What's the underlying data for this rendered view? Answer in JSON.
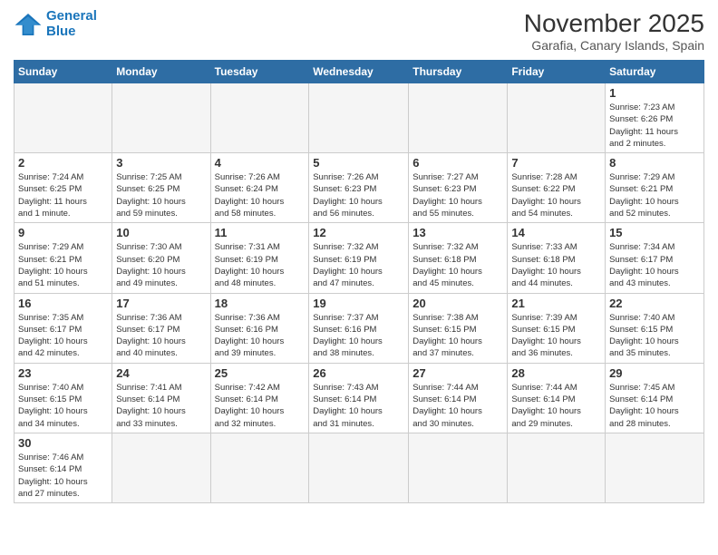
{
  "logo": {
    "line1": "General",
    "line2": "Blue"
  },
  "header": {
    "title": "November 2025",
    "subtitle": "Garafia, Canary Islands, Spain"
  },
  "weekdays": [
    "Sunday",
    "Monday",
    "Tuesday",
    "Wednesday",
    "Thursday",
    "Friday",
    "Saturday"
  ],
  "weeks": [
    [
      {
        "day": "",
        "info": ""
      },
      {
        "day": "",
        "info": ""
      },
      {
        "day": "",
        "info": ""
      },
      {
        "day": "",
        "info": ""
      },
      {
        "day": "",
        "info": ""
      },
      {
        "day": "",
        "info": ""
      },
      {
        "day": "1",
        "info": "Sunrise: 7:23 AM\nSunset: 6:26 PM\nDaylight: 11 hours\nand 2 minutes."
      }
    ],
    [
      {
        "day": "2",
        "info": "Sunrise: 7:24 AM\nSunset: 6:25 PM\nDaylight: 11 hours\nand 1 minute."
      },
      {
        "day": "3",
        "info": "Sunrise: 7:25 AM\nSunset: 6:25 PM\nDaylight: 10 hours\nand 59 minutes."
      },
      {
        "day": "4",
        "info": "Sunrise: 7:26 AM\nSunset: 6:24 PM\nDaylight: 10 hours\nand 58 minutes."
      },
      {
        "day": "5",
        "info": "Sunrise: 7:26 AM\nSunset: 6:23 PM\nDaylight: 10 hours\nand 56 minutes."
      },
      {
        "day": "6",
        "info": "Sunrise: 7:27 AM\nSunset: 6:23 PM\nDaylight: 10 hours\nand 55 minutes."
      },
      {
        "day": "7",
        "info": "Sunrise: 7:28 AM\nSunset: 6:22 PM\nDaylight: 10 hours\nand 54 minutes."
      },
      {
        "day": "8",
        "info": "Sunrise: 7:29 AM\nSunset: 6:21 PM\nDaylight: 10 hours\nand 52 minutes."
      }
    ],
    [
      {
        "day": "9",
        "info": "Sunrise: 7:29 AM\nSunset: 6:21 PM\nDaylight: 10 hours\nand 51 minutes."
      },
      {
        "day": "10",
        "info": "Sunrise: 7:30 AM\nSunset: 6:20 PM\nDaylight: 10 hours\nand 49 minutes."
      },
      {
        "day": "11",
        "info": "Sunrise: 7:31 AM\nSunset: 6:19 PM\nDaylight: 10 hours\nand 48 minutes."
      },
      {
        "day": "12",
        "info": "Sunrise: 7:32 AM\nSunset: 6:19 PM\nDaylight: 10 hours\nand 47 minutes."
      },
      {
        "day": "13",
        "info": "Sunrise: 7:32 AM\nSunset: 6:18 PM\nDaylight: 10 hours\nand 45 minutes."
      },
      {
        "day": "14",
        "info": "Sunrise: 7:33 AM\nSunset: 6:18 PM\nDaylight: 10 hours\nand 44 minutes."
      },
      {
        "day": "15",
        "info": "Sunrise: 7:34 AM\nSunset: 6:17 PM\nDaylight: 10 hours\nand 43 minutes."
      }
    ],
    [
      {
        "day": "16",
        "info": "Sunrise: 7:35 AM\nSunset: 6:17 PM\nDaylight: 10 hours\nand 42 minutes."
      },
      {
        "day": "17",
        "info": "Sunrise: 7:36 AM\nSunset: 6:17 PM\nDaylight: 10 hours\nand 40 minutes."
      },
      {
        "day": "18",
        "info": "Sunrise: 7:36 AM\nSunset: 6:16 PM\nDaylight: 10 hours\nand 39 minutes."
      },
      {
        "day": "19",
        "info": "Sunrise: 7:37 AM\nSunset: 6:16 PM\nDaylight: 10 hours\nand 38 minutes."
      },
      {
        "day": "20",
        "info": "Sunrise: 7:38 AM\nSunset: 6:15 PM\nDaylight: 10 hours\nand 37 minutes."
      },
      {
        "day": "21",
        "info": "Sunrise: 7:39 AM\nSunset: 6:15 PM\nDaylight: 10 hours\nand 36 minutes."
      },
      {
        "day": "22",
        "info": "Sunrise: 7:40 AM\nSunset: 6:15 PM\nDaylight: 10 hours\nand 35 minutes."
      }
    ],
    [
      {
        "day": "23",
        "info": "Sunrise: 7:40 AM\nSunset: 6:15 PM\nDaylight: 10 hours\nand 34 minutes."
      },
      {
        "day": "24",
        "info": "Sunrise: 7:41 AM\nSunset: 6:14 PM\nDaylight: 10 hours\nand 33 minutes."
      },
      {
        "day": "25",
        "info": "Sunrise: 7:42 AM\nSunset: 6:14 PM\nDaylight: 10 hours\nand 32 minutes."
      },
      {
        "day": "26",
        "info": "Sunrise: 7:43 AM\nSunset: 6:14 PM\nDaylight: 10 hours\nand 31 minutes."
      },
      {
        "day": "27",
        "info": "Sunrise: 7:44 AM\nSunset: 6:14 PM\nDaylight: 10 hours\nand 30 minutes."
      },
      {
        "day": "28",
        "info": "Sunrise: 7:44 AM\nSunset: 6:14 PM\nDaylight: 10 hours\nand 29 minutes."
      },
      {
        "day": "29",
        "info": "Sunrise: 7:45 AM\nSunset: 6:14 PM\nDaylight: 10 hours\nand 28 minutes."
      }
    ],
    [
      {
        "day": "30",
        "info": "Sunrise: 7:46 AM\nSunset: 6:14 PM\nDaylight: 10 hours\nand 27 minutes."
      },
      {
        "day": "",
        "info": ""
      },
      {
        "day": "",
        "info": ""
      },
      {
        "day": "",
        "info": ""
      },
      {
        "day": "",
        "info": ""
      },
      {
        "day": "",
        "info": ""
      },
      {
        "day": "",
        "info": ""
      }
    ]
  ]
}
